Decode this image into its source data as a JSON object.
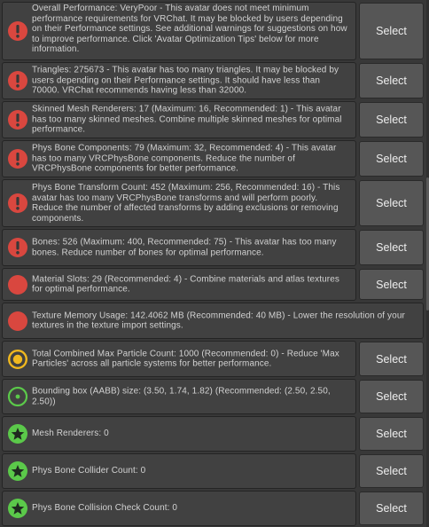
{
  "colors": {
    "background": "#383838",
    "message_box": "#414141",
    "button": "#565656",
    "error_red": "#d9473f",
    "warning_yellow": "#f0b81f",
    "info_green": "#5bc94a"
  },
  "select_label": "Select",
  "messages": [
    {
      "severity": "error-exclamation",
      "icon": "error-exclamation-icon",
      "text": "Overall Performance: VeryPoor - This avatar does not meet minimum performance requirements for VRChat. It may be blocked by users depending on their Performance settings. See additional warnings for suggestions on how to improve performance. Click 'Avatar Optimization Tips' below for more information.",
      "has_select": true
    },
    {
      "severity": "error-exclamation",
      "icon": "error-exclamation-icon",
      "text": "Triangles: 275673 - This avatar has too many triangles. It may be blocked by users depending on their Performance settings. It should have less than 70000. VRChat recommends having less than 32000.",
      "has_select": true
    },
    {
      "severity": "error-exclamation",
      "icon": "error-exclamation-icon",
      "text": "Skinned Mesh Renderers: 17 (Maximum: 16, Recommended: 1) - This avatar has too many skinned meshes. Combine multiple skinned meshes for optimal performance.",
      "has_select": true
    },
    {
      "severity": "error-exclamation",
      "icon": "error-exclamation-icon",
      "text": "Phys Bone Components: 79 (Maximum: 32, Recommended: 4) - This avatar has too many VRCPhysBone components. Reduce the number of VRCPhysBone components for better performance.",
      "has_select": true
    },
    {
      "severity": "error-exclamation",
      "icon": "error-exclamation-icon",
      "text": "Phys Bone Transform Count: 452 (Maximum: 256, Recommended: 16) - This avatar has too many VRCPhysBone transforms and will perform poorly. Reduce the number of affected transforms by adding exclusions or removing components.",
      "has_select": true
    },
    {
      "severity": "error-exclamation",
      "icon": "error-exclamation-icon",
      "text": "Bones: 526 (Maximum: 400, Recommended: 75) - This avatar has too many bones. Reduce number of bones for optimal performance.",
      "has_select": true
    },
    {
      "severity": "error-solid",
      "icon": "red-circle-icon",
      "text": "Material Slots: 29 (Recommended: 4) - Combine materials and atlas textures for optimal performance.",
      "has_select": true
    },
    {
      "severity": "error-solid",
      "icon": "red-circle-icon",
      "text": "Texture Memory Usage: 142.4062 MB (Recommended: 40 MB) - Lower the resolution of your textures in the texture import settings.",
      "has_select": false
    },
    {
      "severity": "warning",
      "icon": "yellow-ring-icon",
      "text": "Total Combined Max Particle Count: 1000 (Recommended: 0) - Reduce 'Max Particles' across all particle systems for better performance.",
      "has_select": true
    },
    {
      "severity": "info",
      "icon": "green-dot-ring-icon",
      "text": "Bounding box (AABB) size: (3.50, 1.74, 1.82) (Recommended: (2.50, 2.50, 2.50))",
      "has_select": true
    },
    {
      "severity": "excellent",
      "icon": "green-star-icon",
      "text": "Mesh Renderers: 0",
      "has_select": true
    },
    {
      "severity": "excellent",
      "icon": "green-star-icon",
      "text": "Phys Bone Collider Count: 0",
      "has_select": true
    },
    {
      "severity": "excellent",
      "icon": "green-star-icon",
      "text": "Phys Bone Collision Check Count: 0",
      "has_select": true
    }
  ]
}
